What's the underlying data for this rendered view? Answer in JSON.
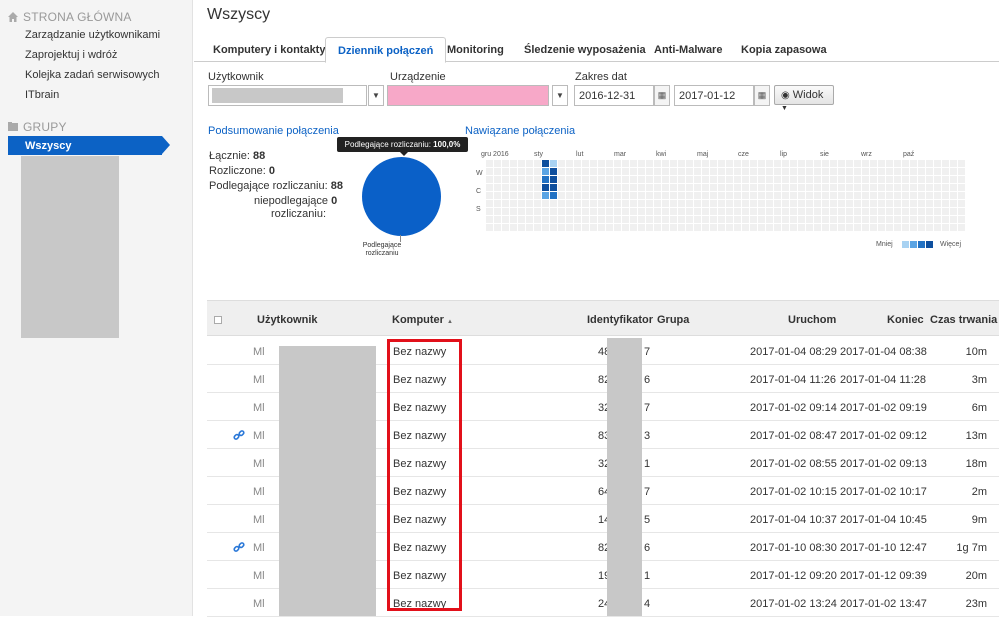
{
  "sidebar": {
    "home_label": "STRONA GŁÓWNA",
    "home_items": [
      "Zarządzanie użytkownikami",
      "Zaprojektuj i wdróż",
      "Kolejka zadań serwisowych",
      "ITbrain"
    ],
    "groups_label": "GRUPY",
    "active_group": "Wszyscy"
  },
  "page": {
    "title": "Wszyscy"
  },
  "tabs": [
    {
      "label": "Komputery i kontakty"
    },
    {
      "label": "Dziennik połączeń"
    },
    {
      "label": "Monitoring"
    },
    {
      "label": "Śledzenie wyposażenia"
    },
    {
      "label": "Anti-Malware"
    },
    {
      "label": "Kopia zapasowa"
    }
  ],
  "filters": {
    "user_label": "Użytkownik",
    "device_label": "Urządzenie",
    "date_range_label": "Zakres dat",
    "date_from": "2016-12-31",
    "date_to": "2017-01-12",
    "view_button": "Widok"
  },
  "summary": {
    "title": "Podsumowanie połączenia",
    "total_label": "Łącznie:",
    "total_value": "88",
    "billed_label": "Rozliczone:",
    "billed_value": "0",
    "billable_label": "Podlegające rozliczaniu:",
    "billable_value": "88",
    "nonbillable_label_1": "niepodlegające",
    "nonbillable_value": "0",
    "nonbillable_label_2": "rozliczaniu:",
    "tooltip_prefix": "Podlegające rozliczaniu: ",
    "tooltip_value": "100,0%",
    "pie_label_1": "Podlegające",
    "pie_label_2": "rozliczaniu"
  },
  "chart_data": {
    "type": "pie",
    "categories": [
      "Podlegające rozliczaniu"
    ],
    "values": [
      100.0
    ],
    "colors": [
      "#0a60c8"
    ]
  },
  "connections": {
    "title": "Nawiązane połączenia",
    "months": [
      "gru 2016",
      "sty",
      "lut",
      "mar",
      "kwi",
      "maj",
      "cze",
      "lip",
      "sie",
      "wrz",
      "paź"
    ],
    "weekdays": [
      "W",
      "C",
      "S"
    ],
    "legend_less": "Mniej",
    "legend_more": "Więcej",
    "legend_colors": [
      "#a8d2f2",
      "#5aa4e4",
      "#2272c4",
      "#0e4f9e"
    ],
    "cells": [
      {
        "col": 7,
        "row": 0,
        "level": 3
      },
      {
        "col": 8,
        "row": 0,
        "level": 0
      },
      {
        "col": 7,
        "row": 1,
        "level": 1
      },
      {
        "col": 8,
        "row": 1,
        "level": 3
      },
      {
        "col": 7,
        "row": 2,
        "level": 2
      },
      {
        "col": 8,
        "row": 2,
        "level": 3
      },
      {
        "col": 7,
        "row": 3,
        "level": 3
      },
      {
        "col": 8,
        "row": 3,
        "level": 3
      },
      {
        "col": 7,
        "row": 4,
        "level": 1
      },
      {
        "col": 8,
        "row": 4,
        "level": 2
      }
    ]
  },
  "table": {
    "headers": {
      "user": "Użytkownik",
      "computer": "Komputer",
      "id": "Identyfikator",
      "group": "Grupa",
      "start": "Uruchom",
      "end": "Koniec",
      "duration": "Czas trwania"
    },
    "rows": [
      {
        "user": "Ml",
        "computer": "Bez nazwy",
        "id_start": "48",
        "id_end": "7",
        "start": "2017-01-04 08:29",
        "end": "2017-01-04 08:38",
        "duration": "10m",
        "linked": false
      },
      {
        "user": "Ml",
        "computer": "Bez nazwy",
        "id_start": "82",
        "id_end": "6",
        "start": "2017-01-04 11:26",
        "end": "2017-01-04 11:28",
        "duration": "3m",
        "linked": false
      },
      {
        "user": "Ml",
        "computer": "Bez nazwy",
        "id_start": "32",
        "id_end": "7",
        "start": "2017-01-02 09:14",
        "end": "2017-01-02 09:19",
        "duration": "6m",
        "linked": false
      },
      {
        "user": "Ml",
        "computer": "Bez nazwy",
        "id_start": "83",
        "id_end": "3",
        "start": "2017-01-02 08:47",
        "end": "2017-01-02 09:12",
        "duration": "13m",
        "linked": true
      },
      {
        "user": "Ml",
        "computer": "Bez nazwy",
        "id_start": "32",
        "id_end": "1",
        "start": "2017-01-02 08:55",
        "end": "2017-01-02 09:13",
        "duration": "18m",
        "linked": false
      },
      {
        "user": "Ml",
        "computer": "Bez nazwy",
        "id_start": "64",
        "id_end": "7",
        "start": "2017-01-02 10:15",
        "end": "2017-01-02 10:17",
        "duration": "2m",
        "linked": false
      },
      {
        "user": "Ml",
        "computer": "Bez nazwy",
        "id_start": "14",
        "id_end": "5",
        "start": "2017-01-04 10:37",
        "end": "2017-01-04 10:45",
        "duration": "9m",
        "linked": false
      },
      {
        "user": "Ml",
        "computer": "Bez nazwy",
        "id_start": "82",
        "id_end": "6",
        "start": "2017-01-10 08:30",
        "end": "2017-01-10 12:47",
        "duration": "1g 7m",
        "linked": true
      },
      {
        "user": "Ml",
        "computer": "Bez nazwy",
        "id_start": "19",
        "id_end": "1",
        "start": "2017-01-12 09:20",
        "end": "2017-01-12 09:39",
        "duration": "20m",
        "linked": false
      },
      {
        "user": "Ml",
        "computer": "Bez nazwy",
        "id_start": "24",
        "id_end": "4",
        "start": "2017-01-02 13:24",
        "end": "2017-01-02 13:47",
        "duration": "23m",
        "linked": false
      }
    ]
  }
}
